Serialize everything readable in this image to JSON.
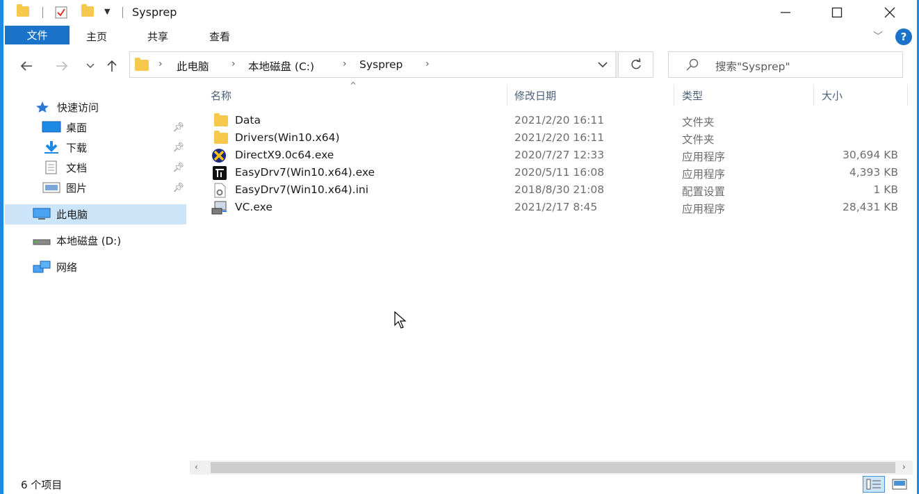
{
  "window": {
    "title": "Sysprep",
    "minimize": "—",
    "maximize": "☐",
    "close": "✕"
  },
  "ribbon": {
    "tabs": [
      "文件",
      "主页",
      "共享",
      "查看"
    ],
    "expand": "﹀",
    "help": "?"
  },
  "address": {
    "breadcrumb": [
      "此电脑",
      "本地磁盘 (C:)",
      "Sysprep"
    ],
    "search_placeholder": "搜索\"Sysprep\""
  },
  "navigation": {
    "quick_access": "快速访问",
    "pinned": [
      "桌面",
      "下载",
      "文档",
      "图片"
    ],
    "this_pc": "此电脑",
    "drive_d": "本地磁盘 (D:)",
    "network": "网络"
  },
  "columns": [
    "名称",
    "修改日期",
    "类型",
    "大小"
  ],
  "files": [
    {
      "name": "Data",
      "date": "2021/2/20 16:11",
      "type": "文件夹",
      "size": "",
      "icon": "folder-icon"
    },
    {
      "name": "Drivers(Win10.x64)",
      "date": "2021/2/20 16:11",
      "type": "文件夹",
      "size": "",
      "icon": "folder-icon"
    },
    {
      "name": "DirectX9.0c64.exe",
      "date": "2020/7/27 12:33",
      "type": "应用程序",
      "size": "30,694 KB",
      "icon": "directx-icon"
    },
    {
      "name": "EasyDrv7(Win10.x64).exe",
      "date": "2020/5/11 16:08",
      "type": "应用程序",
      "size": "4,393 KB",
      "icon": "easydrv-icon"
    },
    {
      "name": "EasyDrv7(Win10.x64).ini",
      "date": "2018/8/30 21:08",
      "type": "配置设置",
      "size": "1 KB",
      "icon": "config-file-icon"
    },
    {
      "name": "VC.exe",
      "date": "2021/2/17 8:45",
      "type": "应用程序",
      "size": "28,431 KB",
      "icon": "installer-icon"
    }
  ],
  "status": {
    "item_count": "6 个项目"
  },
  "colors": {
    "accent": "#1a73c9",
    "selection": "#cce4f7",
    "folder": "#f6c94c"
  }
}
